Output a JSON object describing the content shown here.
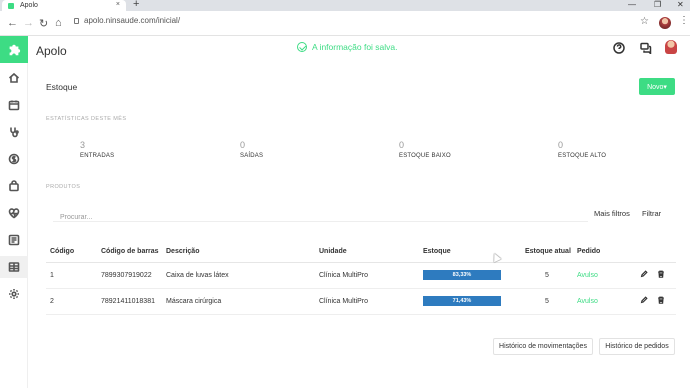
{
  "browser": {
    "tab_title": "Apolo",
    "tab_close": "×",
    "new_tab": "+",
    "url": "apolo.ninsaude.com/inicial/",
    "window_controls": [
      "—",
      "❐",
      "✕"
    ]
  },
  "app": {
    "title": "Apolo",
    "toast": "A informação foi salva.",
    "brand_color": "#3ddc84"
  },
  "sidebar": {
    "items": [
      {
        "name": "home-icon"
      },
      {
        "name": "calendar-icon"
      },
      {
        "name": "stethoscope-icon"
      },
      {
        "name": "dollar-icon"
      },
      {
        "name": "bag-icon"
      },
      {
        "name": "heartbeat-icon"
      },
      {
        "name": "report-icon"
      },
      {
        "name": "inventory-icon"
      },
      {
        "name": "settings-icon"
      }
    ]
  },
  "page": {
    "title": "Estoque",
    "new_button": "Novo▾"
  },
  "stats": {
    "caption": "ESTATÍSTICAS DESTE MÊS",
    "items": [
      {
        "value": "3",
        "label": "ENTRADAS"
      },
      {
        "value": "0",
        "label": "SAÍDAS"
      },
      {
        "value": "0",
        "label": "ESTOQUE BAIXO"
      },
      {
        "value": "0",
        "label": "ESTOQUE ALTO"
      }
    ]
  },
  "products": {
    "caption": "PRODUTOS",
    "search_placeholder": "Procurar...",
    "more_filters": "Mais filtros",
    "filter": "Filtrar",
    "columns": [
      "Código",
      "Código de barras",
      "Descrição",
      "Unidade",
      "Estoque",
      "Estoque atual",
      "Pedido"
    ],
    "rows": [
      {
        "code": "1",
        "barcode": "7899307919022",
        "description": "Caixa de luvas látex",
        "unit": "Clínica MultiPro",
        "stock_pct": "83,33%",
        "current": "5",
        "order": "Avulso"
      },
      {
        "code": "2",
        "barcode": "7892141101838​1",
        "description": "Máscara cirúrgica",
        "unit": "Clínica MultiPro",
        "stock_pct": "71,43%",
        "current": "5",
        "order": "Avulso"
      }
    ]
  },
  "footer": {
    "history_movements": "Histórico de movimentações",
    "history_orders": "Histórico de pedidos"
  }
}
